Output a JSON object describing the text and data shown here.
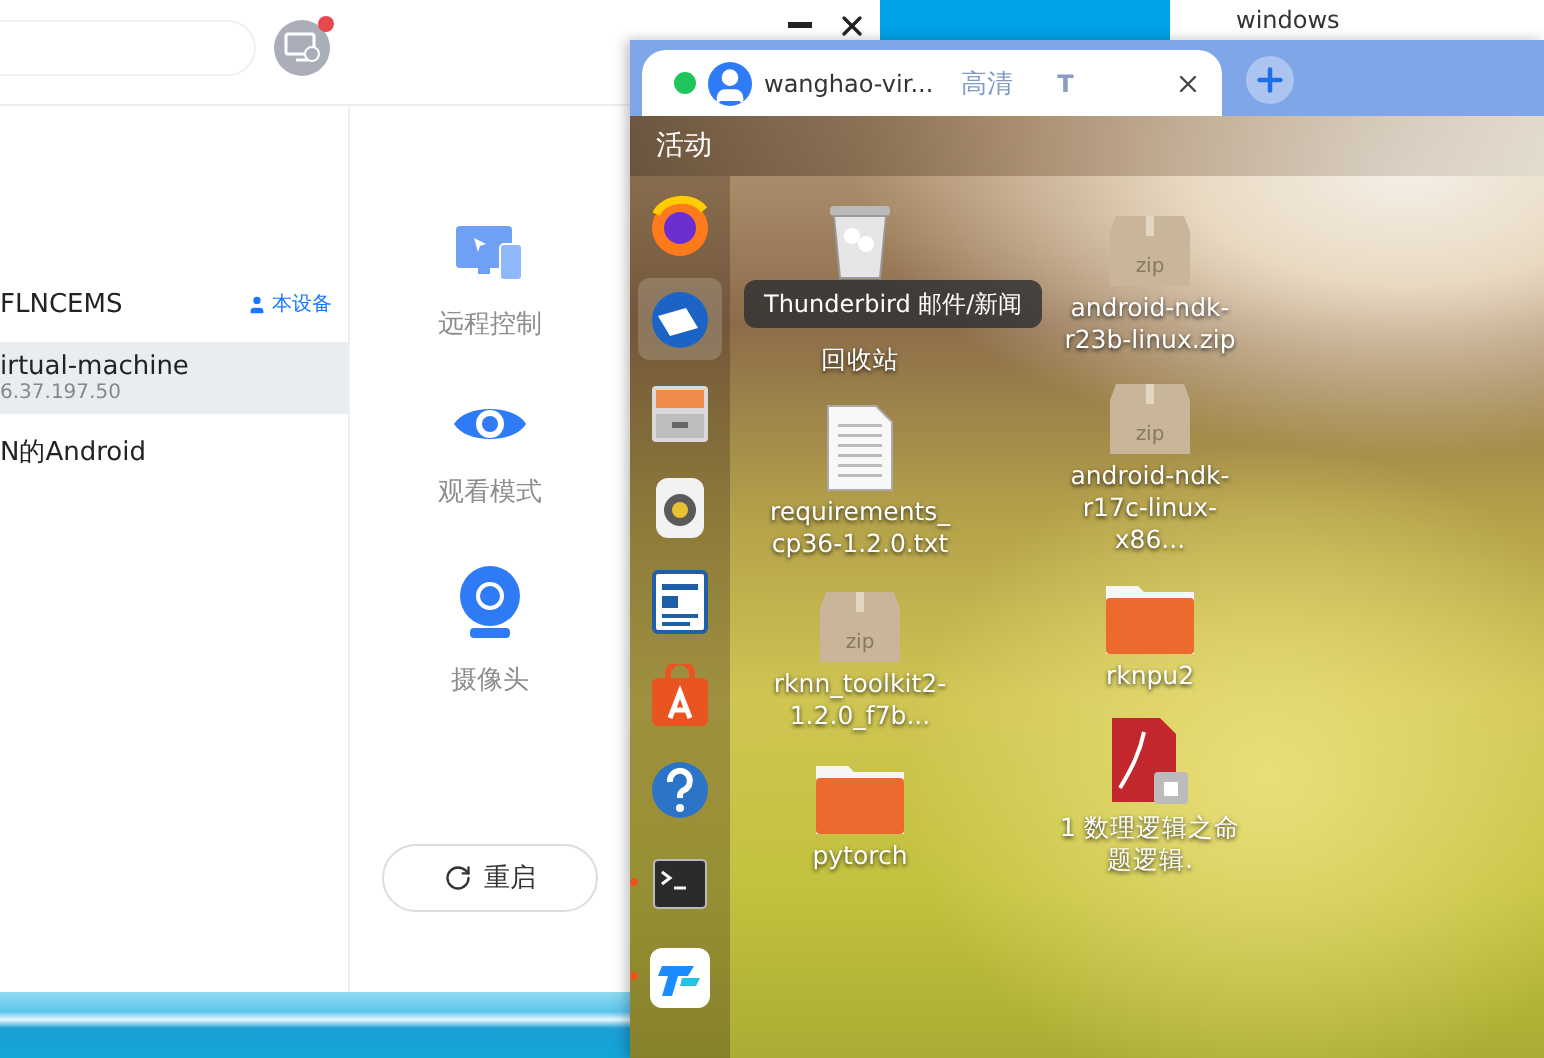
{
  "app": {
    "devices": [
      {
        "name": "FLNCEMS",
        "badge": "本设备",
        "selected": false
      },
      {
        "name": "irtual-machine",
        "address": "6.37.197.50",
        "selected": true
      },
      {
        "name": "N的Android",
        "selected": false
      }
    ],
    "actions": [
      {
        "kind": "remote",
        "label": "远程控制"
      },
      {
        "kind": "watch",
        "label": "观看模式"
      },
      {
        "kind": "camera",
        "label": "摄像头"
      }
    ],
    "restart_button": {
      "label": "重启"
    }
  },
  "other_window": {
    "title": "windows"
  },
  "remote_window": {
    "tabs": [
      {
        "title": "wanghao-vir...",
        "quality": "高清",
        "mode": "T",
        "online": true,
        "selected": true
      }
    ],
    "desktop": {
      "top_bar": "活动",
      "tooltip": "Thunderbird 邮件/新闻",
      "dock": [
        {
          "kind": "firefox",
          "selected": false,
          "running": false
        },
        {
          "kind": "mail",
          "selected": true,
          "running": false
        },
        {
          "kind": "files",
          "selected": false,
          "running": false
        },
        {
          "kind": "speaker",
          "selected": false,
          "running": false
        },
        {
          "kind": "document",
          "selected": false,
          "running": false
        },
        {
          "kind": "store",
          "selected": false,
          "running": false
        },
        {
          "kind": "help",
          "selected": false,
          "running": false
        },
        {
          "kind": "terminal",
          "selected": false,
          "running": true
        },
        {
          "kind": "remote",
          "selected": false,
          "running": true
        }
      ],
      "icon_columns": [
        [
          {
            "kind": "trash",
            "label": "回收站"
          },
          {
            "kind": "text",
            "label": "requirements_cp36-1.2.0.txt"
          },
          {
            "kind": "zip",
            "label": "rknn_toolkit2-1.2.0_f7b..."
          },
          {
            "kind": "folder",
            "label": "pytorch"
          }
        ],
        [
          {
            "kind": "zip",
            "label": "android-ndk-r23b-linux.zip"
          },
          {
            "kind": "zip",
            "label": "android-ndk-r17c-linux-x86..."
          },
          {
            "kind": "folder",
            "label": "rknpu2"
          },
          {
            "kind": "pdf",
            "label": "1 数理逻辑之命题逻辑."
          }
        ]
      ]
    }
  }
}
